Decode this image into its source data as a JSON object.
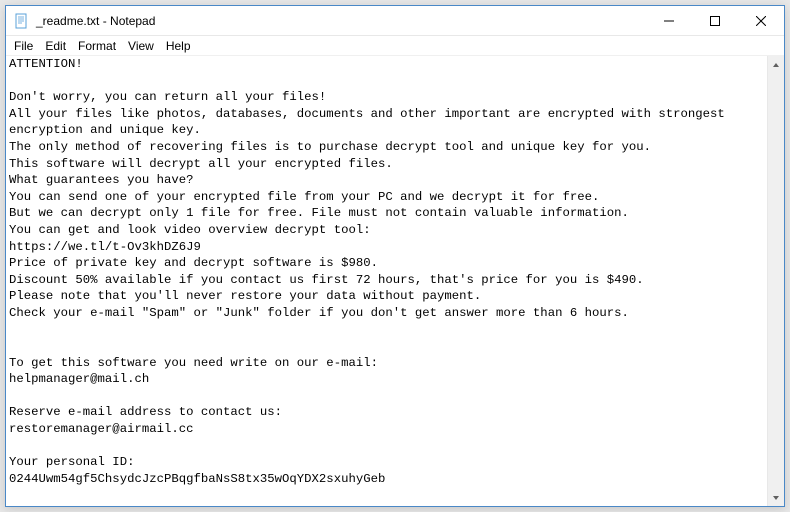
{
  "window": {
    "title": "_readme.txt - Notepad"
  },
  "menu": {
    "file": "File",
    "edit": "Edit",
    "format": "Format",
    "view": "View",
    "help": "Help"
  },
  "body": "ATTENTION!\n\nDon't worry, you can return all your files!\nAll your files like photos, databases, documents and other important are encrypted with strongest encryption and unique key.\nThe only method of recovering files is to purchase decrypt tool and unique key for you.\nThis software will decrypt all your encrypted files.\nWhat guarantees you have?\nYou can send one of your encrypted file from your PC and we decrypt it for free.\nBut we can decrypt only 1 file for free. File must not contain valuable information.\nYou can get and look video overview decrypt tool:\nhttps://we.tl/t-Ov3khDZ6J9\nPrice of private key and decrypt software is $980.\nDiscount 50% available if you contact us first 72 hours, that's price for you is $490.\nPlease note that you'll never restore your data without payment.\nCheck your e-mail \"Spam\" or \"Junk\" folder if you don't get answer more than 6 hours.\n\n\nTo get this software you need write on our e-mail:\nhelpmanager@mail.ch\n\nReserve e-mail address to contact us:\nrestoremanager@airmail.cc\n\nYour personal ID:\n0244Uwm54gf5ChsydcJzcPBqgfbaNsS8tx35wOqYDX2sxuhyGeb"
}
